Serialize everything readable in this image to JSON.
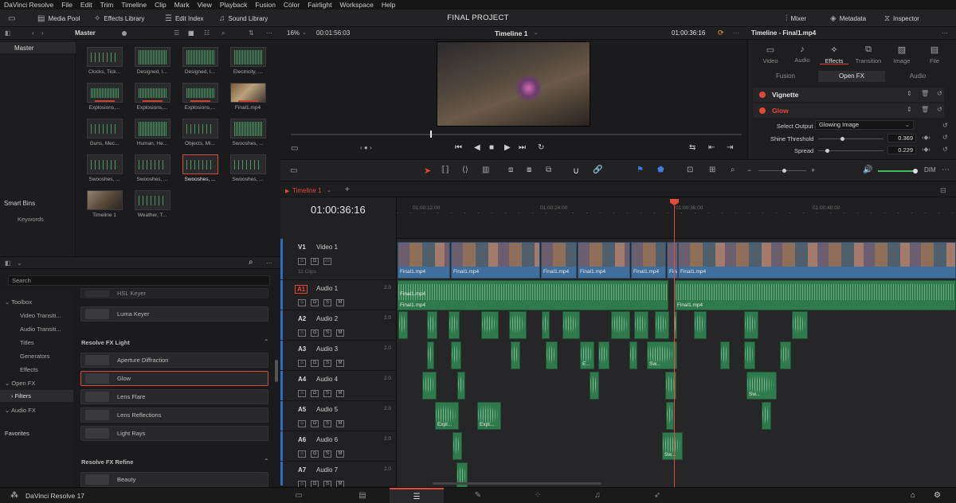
{
  "menubar": [
    "DaVinci Resolve",
    "File",
    "Edit",
    "Trim",
    "Timeline",
    "Clip",
    "Mark",
    "View",
    "Playback",
    "Fusion",
    "Color",
    "Fairlight",
    "Workspace",
    "Help"
  ],
  "toolbar": {
    "media_pool": "Media Pool",
    "effects_library": "Effects Library",
    "edit_index": "Edit Index",
    "sound_library": "Sound Library",
    "project_title": "FINAL PROJECT",
    "mixer": "Mixer",
    "metadata": "Metadata",
    "inspector": "Inspector"
  },
  "media_pool": {
    "bin_title": "Master",
    "bins": [
      "Master"
    ],
    "smart_bins": "Smart Bins",
    "keywords": "Keywords",
    "clips": [
      "Clocks, Tick...",
      "Designed, I...",
      "Designed, I...",
      "Electricity, ...",
      "Explosions,...",
      "Explosions,...",
      "Explosions,...",
      "Final1.mp4",
      "Guns, Mec...",
      "Human, He...",
      "Objects, Mi...",
      "Swooshes, ...",
      "Swooshes, ...",
      "Swooshes, ...",
      "Swooshes, ...",
      "Swooshes, ...",
      "Timeline 1",
      "Weather, T..."
    ]
  },
  "effects": {
    "search_placeholder": "Search",
    "tree": [
      {
        "label": "Toolbox",
        "level": 0
      },
      {
        "label": "Video Transiti...",
        "level": 1
      },
      {
        "label": "Audio Transiti...",
        "level": 1
      },
      {
        "label": "Titles",
        "level": 1
      },
      {
        "label": "Generators",
        "level": 1
      },
      {
        "label": "Effects",
        "level": 1
      },
      {
        "label": "Open FX",
        "level": 0
      },
      {
        "label": "Filters",
        "level": 1
      },
      {
        "label": "Audio FX",
        "level": 0
      }
    ],
    "favorites": "Favorites",
    "items": [
      {
        "label": "HSL Keyer"
      },
      {
        "label": "Luma Keyer"
      },
      {
        "category": "Resolve FX Light"
      },
      {
        "label": "Aperture Diffraction"
      },
      {
        "label": "Glow"
      },
      {
        "label": "Lens Flare"
      },
      {
        "label": "Lens Reflections"
      },
      {
        "label": "Light Rays"
      },
      {
        "category": "Resolve FX Refine"
      },
      {
        "label": "Beauty"
      }
    ]
  },
  "viewer": {
    "zoom": "16%",
    "source_tc": "00:01:56:03",
    "timeline_name": "Timeline 1",
    "record_tc": "01:00:36:16"
  },
  "timeline": {
    "tab": "Timeline 1",
    "timecode": "01:00:36:16",
    "ruler": [
      "01:00:12:00",
      "01:00:24:00",
      "01:00:36:00",
      "01:00:48:00"
    ],
    "tracks": [
      {
        "id": "V1",
        "name": "Video 1",
        "sub": "11 Clips"
      },
      {
        "id": "A1",
        "name": "Audio 1",
        "chan": "2.0"
      },
      {
        "id": "A2",
        "name": "Audio 2",
        "chan": "2.0"
      },
      {
        "id": "A3",
        "name": "Audio 3",
        "chan": "2.0"
      },
      {
        "id": "A4",
        "name": "Audio 4",
        "chan": "2.0"
      },
      {
        "id": "A5",
        "name": "Audio 5",
        "chan": "2.0"
      },
      {
        "id": "A6",
        "name": "Audio 6",
        "chan": "2.0"
      },
      {
        "id": "A7",
        "name": "Audio 7",
        "chan": "2.0"
      }
    ],
    "clip_label": "Final1.mp4",
    "audio_labels": [
      "E...",
      "Sw...",
      "Sw...",
      "Expl...",
      "Expl...",
      "Sw..."
    ]
  },
  "inspector": {
    "title": "Timeline - Final1.mp4",
    "tabs": [
      "Video",
      "Audio",
      "Effects",
      "Transition",
      "Image",
      "File"
    ],
    "active_tab": "Effects",
    "subtabs": [
      "Fusion",
      "Open FX",
      "Audio"
    ],
    "effects": [
      "Vignette",
      "Glow"
    ],
    "params": {
      "select_output_label": "Select Output",
      "select_output_value": "Glowing Image",
      "shine_label": "Shine Threshold",
      "shine_value": "0.369",
      "spread_label": "Spread",
      "spread_value": "0.229"
    }
  },
  "pagebar": {
    "app": "DaVinci Resolve 17"
  },
  "colors": {
    "accent": "#e2483a",
    "video_clip": "#3e6f9d",
    "audio_clip": "#2e7a4c"
  }
}
